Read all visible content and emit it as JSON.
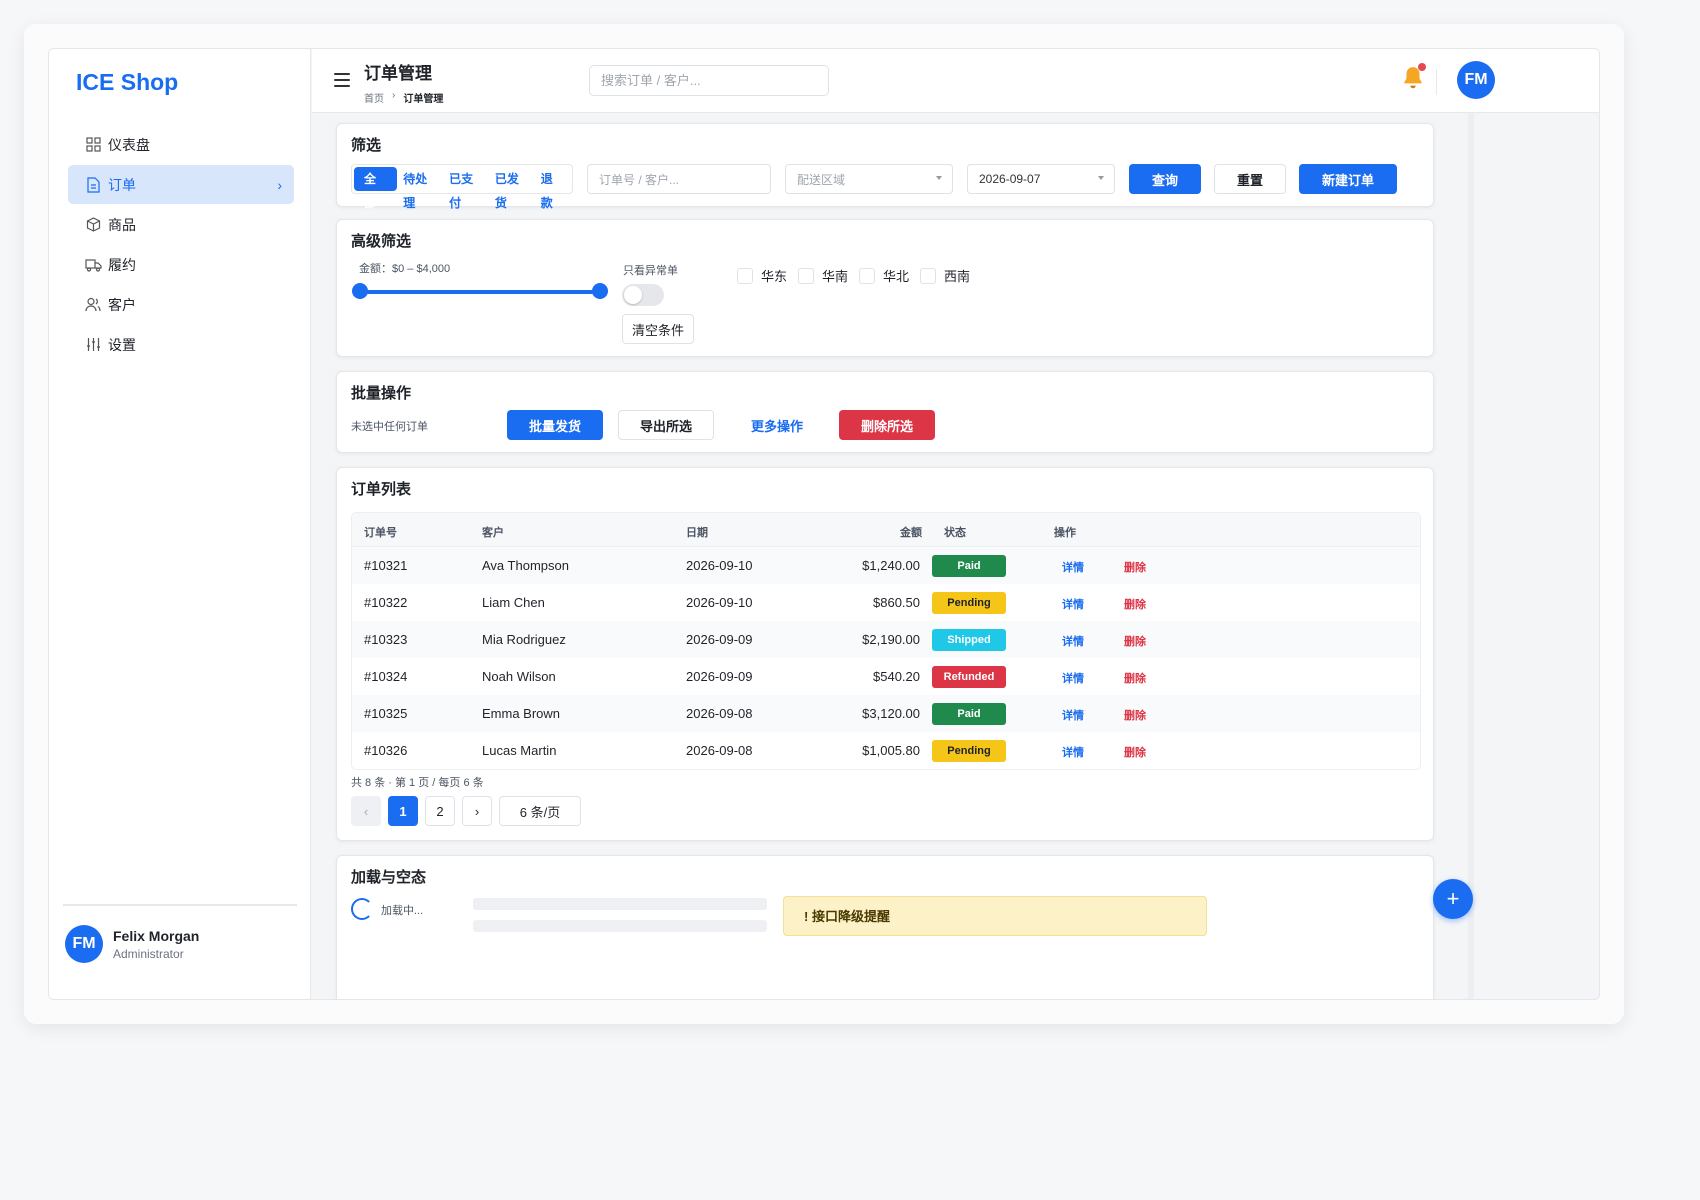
{
  "app": {
    "brand": "ICE Shop"
  },
  "sidebar": {
    "items": [
      {
        "label": "仪表盘",
        "icon": "grid-icon"
      },
      {
        "label": "订单",
        "icon": "document-icon",
        "active": true
      },
      {
        "label": "商品",
        "icon": "cube-icon"
      },
      {
        "label": "履约",
        "icon": "truck-icon"
      },
      {
        "label": "客户",
        "icon": "users-icon"
      },
      {
        "label": "设置",
        "icon": "sliders-icon"
      }
    ],
    "user": {
      "initials": "FM",
      "name": "Felix Morgan",
      "role": "Administrator"
    }
  },
  "header": {
    "title": "订单管理",
    "breadcrumb": {
      "home": "首页",
      "sep": "›",
      "current": "订单管理"
    },
    "search_placeholder": "搜索订单 / 客户...",
    "avatar_initials": "FM"
  },
  "filter": {
    "title": "筛选",
    "tabs": [
      "全部",
      "待处理",
      "已支付",
      "已发货",
      "退款"
    ],
    "keyword_placeholder": "订单号 / 客户...",
    "region_placeholder": "配送区域",
    "date_value": "2026-09-07",
    "query_label": "查询",
    "reset_label": "重置",
    "new_label": "新建订单"
  },
  "advanced": {
    "title": "高级筛选",
    "amount_label": "金额：$0 – $4,000",
    "amount_range": [
      0,
      4000
    ],
    "anomaly_label": "只看异常单",
    "anomaly_on": false,
    "clear_label": "清空条件",
    "regions": [
      "华东",
      "华南",
      "华北",
      "西南"
    ]
  },
  "bulk": {
    "title": "批量操作",
    "hint": "未选中任何订单",
    "ship_label": "批量发货",
    "export_label": "导出所选",
    "more_label": "更多操作",
    "delete_label": "删除所选"
  },
  "orders": {
    "title": "订单列表",
    "columns": {
      "id": "订单号",
      "customer": "客户",
      "date": "日期",
      "amount": "金额",
      "status": "状态",
      "actions": "操作"
    },
    "rows": [
      {
        "id": "#10321",
        "customer": "Ava Thompson",
        "date": "2026-09-10",
        "amount": "$1,240.00",
        "status": "Paid"
      },
      {
        "id": "#10322",
        "customer": "Liam Chen",
        "date": "2026-09-10",
        "amount": "$860.50",
        "status": "Pending"
      },
      {
        "id": "#10323",
        "customer": "Mia Rodriguez",
        "date": "2026-09-09",
        "amount": "$2,190.00",
        "status": "Shipped"
      },
      {
        "id": "#10324",
        "customer": "Noah Wilson",
        "date": "2026-09-09",
        "amount": "$540.20",
        "status": "Refunded"
      },
      {
        "id": "#10325",
        "customer": "Emma Brown",
        "date": "2026-09-08",
        "amount": "$3,120.00",
        "status": "Paid"
      },
      {
        "id": "#10326",
        "customer": "Lucas Martin",
        "date": "2026-09-08",
        "amount": "$1,005.80",
        "status": "Pending"
      }
    ],
    "detail_label": "详情",
    "delete_label": "删除",
    "pager_info": "共 8 条 · 第 1 页 / 每页 6 条",
    "pager": {
      "prev": "‹",
      "pages": [
        "1",
        "2"
      ],
      "next": "›",
      "page_size": "6 条/页"
    },
    "status_colors": {
      "Paid": "#1f8a4c",
      "Pending": "#f5c518",
      "Shipped": "#1ec8e6",
      "Refunded": "#dc3545"
    }
  },
  "loading": {
    "title": "加载与空态",
    "text": "加载中...",
    "warning": "!  接口降级提醒"
  },
  "fab_label": "+"
}
